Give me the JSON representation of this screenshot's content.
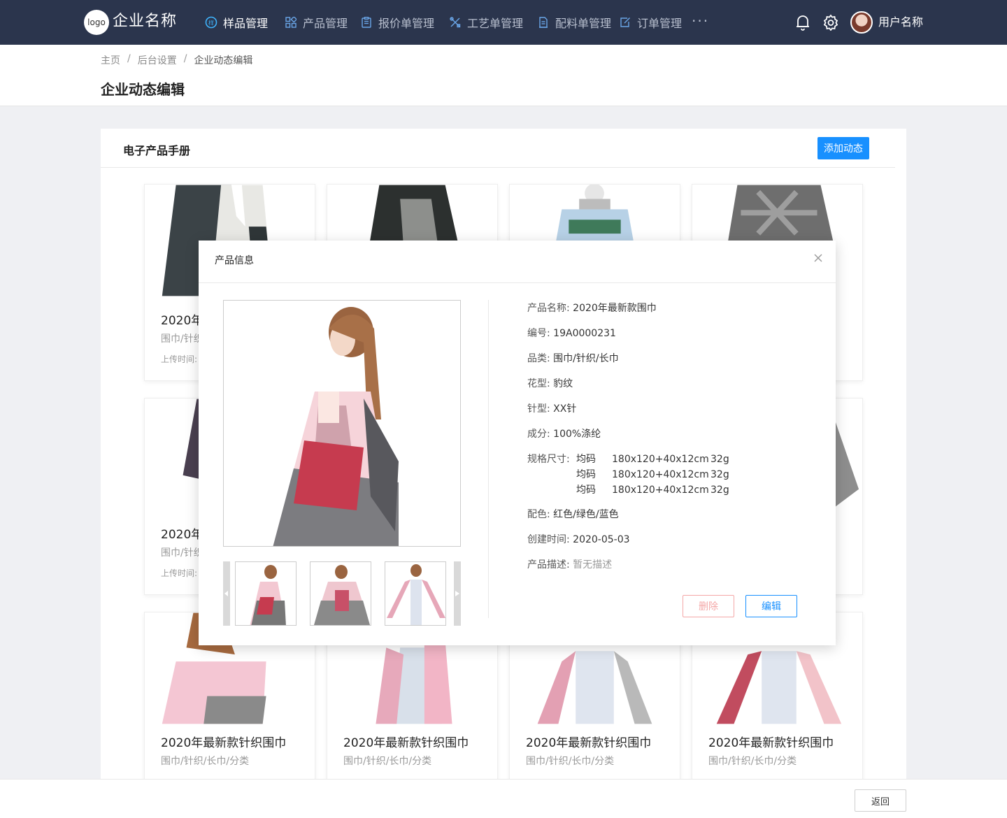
{
  "app": {
    "logo_text": "logo",
    "company_name": "企业名称",
    "username": "用户名称"
  },
  "nav": {
    "items": [
      {
        "label": "样品管理",
        "icon": "sample-icon",
        "active": true
      },
      {
        "label": "产品管理",
        "icon": "product-grid-icon",
        "active": false
      },
      {
        "label": "报价单管理",
        "icon": "clipboard-icon",
        "active": false
      },
      {
        "label": "工艺单管理",
        "icon": "tools-icon",
        "active": false
      },
      {
        "label": "配料单管理",
        "icon": "document-icon",
        "active": false
      },
      {
        "label": "订单管理",
        "icon": "edit-document-icon",
        "active": false
      }
    ],
    "more": "···"
  },
  "breadcrumb": {
    "items": [
      "主页",
      "后台设置",
      "企业动态编辑"
    ],
    "separator": "/"
  },
  "page": {
    "title": "企业动态编辑"
  },
  "panel": {
    "title": "电子产品手册",
    "add_button": "添加动态"
  },
  "cards": {
    "row1": [
      {
        "title": "2020年",
        "category": "围巾/针织",
        "upload": "上传时间:"
      },
      {
        "title": "",
        "category": "",
        "upload": ""
      },
      {
        "title": "",
        "category": "",
        "upload": ""
      },
      {
        "title": "",
        "category": "",
        "upload": ""
      }
    ],
    "row2": [
      {
        "title": "2020年",
        "category": "围巾/针织",
        "upload": "上传时间:"
      }
    ],
    "row3": [
      {
        "title": "2020年最新款针织围巾",
        "category": "围巾/针织/长巾/分类"
      },
      {
        "title": "2020年最新款针织围巾",
        "category": "围巾/针织/长巾/分类"
      },
      {
        "title": "2020年最新款针织围巾",
        "category": "围巾/针织/长巾/分类"
      },
      {
        "title": "2020年最新款针织围巾",
        "category": "围巾/针织/长巾/分类"
      }
    ]
  },
  "footer": {
    "back_button": "返回"
  },
  "modal": {
    "title": "产品信息",
    "fields": {
      "name_label": "产品名称:",
      "name": "2020年最新款围巾",
      "code_label": "编号:",
      "code": "19A0000231",
      "category_label": "品类:",
      "category": "围巾/针织/长巾",
      "pattern_label": "花型:",
      "pattern": "豹纹",
      "needle_label": "针型:",
      "needle": "XX针",
      "composition_label": "成分:",
      "composition": "100%涤纶",
      "spec_label": "规格尺寸:",
      "specs": [
        {
          "size": "均码",
          "dim": "180x120+40x12cm",
          "weight": "32g"
        },
        {
          "size": "均码",
          "dim": "180x120+40x12cm",
          "weight": "32g"
        },
        {
          "size": "均码",
          "dim": "180x120+40x12cm",
          "weight": "32g"
        }
      ],
      "color_label": "配色:",
      "color": "红色/绿色/蓝色",
      "created_label": "创建时间:",
      "created": "2020-05-03",
      "desc_label": "产品描述:",
      "desc": "暂无描述"
    },
    "delete_button": "删除",
    "edit_button": "编辑"
  },
  "colors": {
    "nav_bg": "#2b354d",
    "primary": "#1890ff",
    "danger_light": "#f4a7a7"
  }
}
